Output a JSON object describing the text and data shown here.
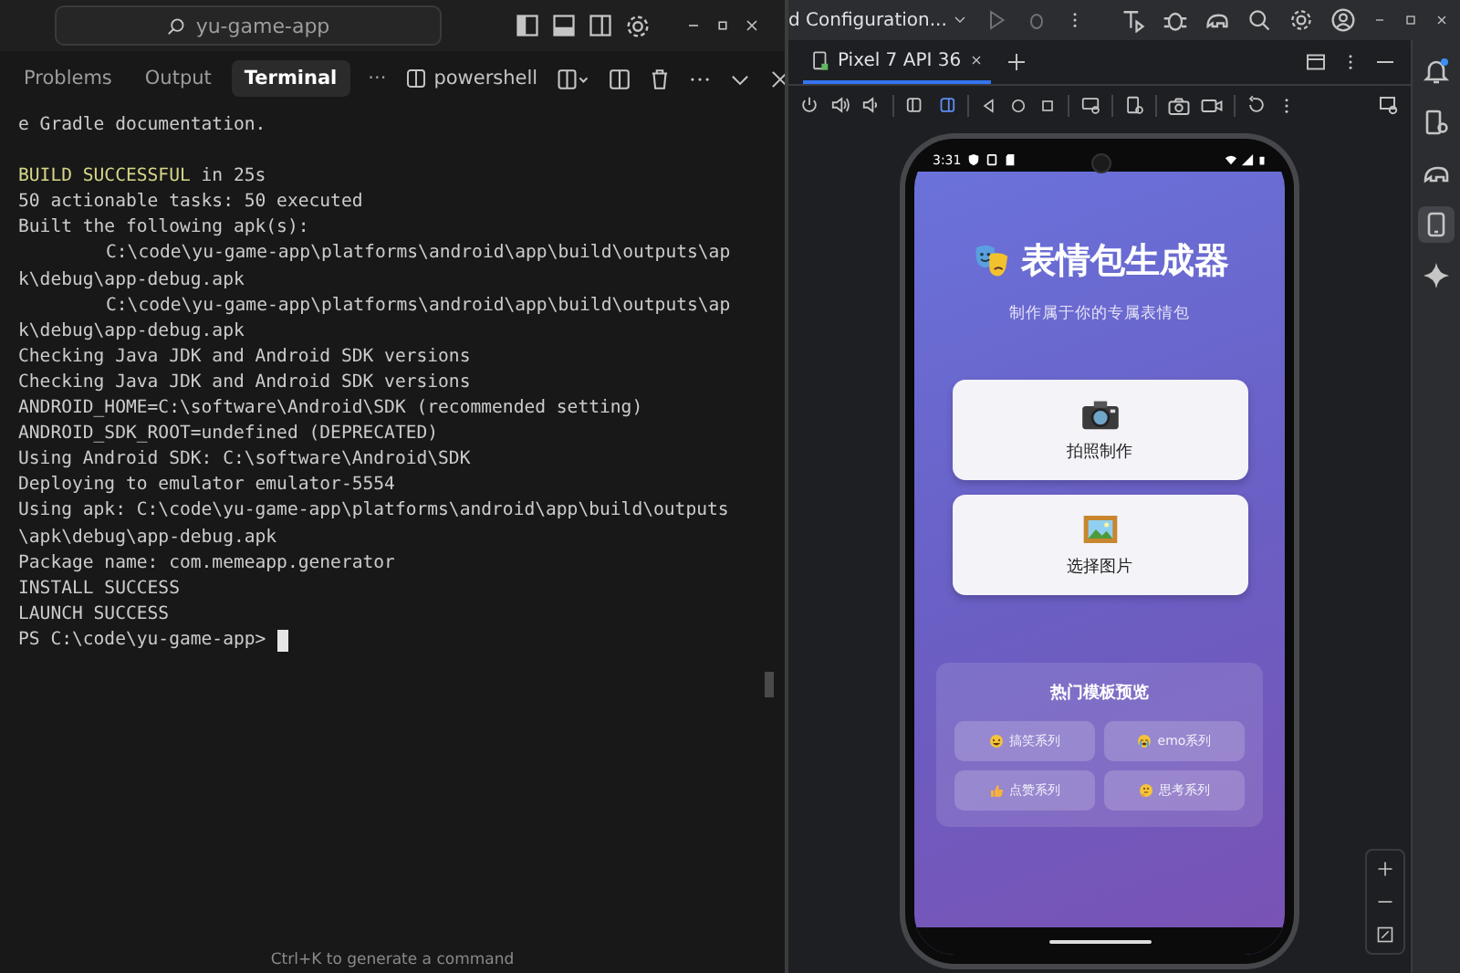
{
  "editor": {
    "search": "yu-game-app",
    "panel_tabs": [
      {
        "label": "Problems",
        "selected": false
      },
      {
        "label": "Output",
        "selected": false
      },
      {
        "label": "Terminal",
        "selected": true
      }
    ],
    "panel_more": "···",
    "terminal_profile": "powershell",
    "terminal_lines": [
      {
        "kind": "text",
        "text": "e Gradle documentation.",
        "indented": false
      },
      {
        "kind": "blank"
      },
      {
        "kind": "status",
        "status": "BUILD SUCCESSFUL",
        "text": " in 25s"
      },
      {
        "kind": "text",
        "text": "50 actionable tasks: 50 executed",
        "indented": false
      },
      {
        "kind": "text",
        "text": "Built the following apk(s):",
        "indented": false
      },
      {
        "kind": "text",
        "text": "C:\\code\\yu-game-app\\platforms\\android\\app\\build\\outputs\\ap",
        "indented": true
      },
      {
        "kind": "text",
        "text": "k\\debug\\app-debug.apk",
        "indented": false
      },
      {
        "kind": "text",
        "text": "C:\\code\\yu-game-app\\platforms\\android\\app\\build\\outputs\\ap",
        "indented": true
      },
      {
        "kind": "text",
        "text": "k\\debug\\app-debug.apk",
        "indented": false
      },
      {
        "kind": "text",
        "text": "Checking Java JDK and Android SDK versions",
        "indented": false
      },
      {
        "kind": "text",
        "text": "Checking Java JDK and Android SDK versions",
        "indented": false
      },
      {
        "kind": "text",
        "text": "ANDROID_HOME=C:\\software\\Android\\SDK (recommended setting)",
        "indented": false
      },
      {
        "kind": "text",
        "text": "ANDROID_SDK_ROOT=undefined (DEPRECATED)",
        "indented": false
      },
      {
        "kind": "text",
        "text": "Using Android SDK: C:\\software\\Android\\SDK",
        "indented": false
      },
      {
        "kind": "text",
        "text": "Deploying to emulator emulator-5554",
        "indented": false
      },
      {
        "kind": "text",
        "text": "Using apk: C:\\code\\yu-game-app\\platforms\\android\\app\\build\\outputs",
        "indented": false
      },
      {
        "kind": "text",
        "text": "\\apk\\debug\\app-debug.apk",
        "indented": false
      },
      {
        "kind": "text",
        "text": "Package name: com.memeapp.generator",
        "indented": false
      },
      {
        "kind": "text",
        "text": "INSTALL SUCCESS",
        "indented": false
      },
      {
        "kind": "text",
        "text": "LAUNCH SUCCESS",
        "indented": false
      }
    ],
    "prompt": "PS C:\\code\\yu-game-app>",
    "hint": "Ctrl+K to generate a command"
  },
  "studio": {
    "run_config": "d Configuration...",
    "device_tabs": [
      {
        "label": "Pixel 7 API 36",
        "selected": true
      }
    ],
    "tool_windows": [
      {
        "kind": "notifications",
        "selected": false
      },
      {
        "kind": "device-manager",
        "selected": false
      },
      {
        "kind": "gradle",
        "selected": false
      },
      {
        "kind": "running-devices",
        "selected": true
      },
      {
        "kind": "assistant",
        "selected": false
      }
    ],
    "phone": {
      "time": "3:31",
      "title": "表情包生成器",
      "subtitle": "制作属于你的专属表情包",
      "actions": [
        {
          "label": "拍照制作",
          "kind": "camera"
        },
        {
          "label": "选择图片",
          "kind": "picture"
        }
      ],
      "templates": {
        "title": "热门模板预览",
        "items": [
          {
            "label": "搞笑系列",
            "kind": "laugh"
          },
          {
            "label": "emo系列",
            "kind": "cry"
          },
          {
            "label": "点赞系列",
            "kind": "thumbs"
          },
          {
            "label": "思考系列",
            "kind": "think"
          }
        ]
      }
    }
  }
}
